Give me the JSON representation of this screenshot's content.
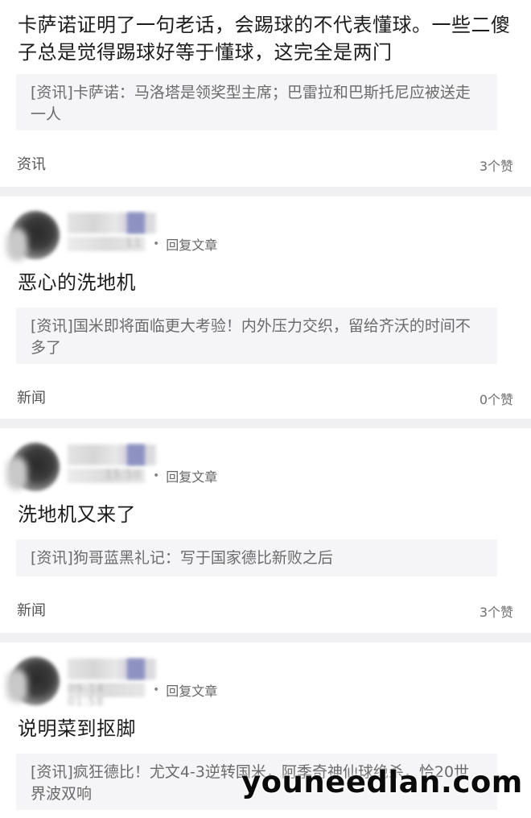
{
  "cards": [
    {
      "comment": "卡萨诺证明了一句老话，会踢球的不代表懂球。一些二傻子总是觉得踢球好等于懂球，这完全是两门",
      "quote": "[资讯]卡萨诺：马洛塔是领奖型主席；巴雷拉和巴斯托尼应被送走一人",
      "tag": "资讯",
      "likes": "3个赞"
    },
    {
      "time_fragment": "11",
      "reply_label": "回复文章",
      "comment": "恶心的洗地机",
      "quote": "[资讯]国米即将面临更大考验！内外压力交织，留给齐沃的时间不多了",
      "tag": "新闻",
      "likes": "0个赞"
    },
    {
      "time_fragment": "15:50",
      "reply_label": "回复文章",
      "comment": "洗地机又来了",
      "quote": "[资讯]狗哥蓝黑礼记：写于国家德比新败之后",
      "tag": "新闻",
      "likes": "3个赞"
    },
    {
      "time_fragment": "09-14 01:58",
      "reply_label": "回复文章",
      "comment": "说明菜到抠脚",
      "quote": "[资讯]疯狂德比！尤文4-3逆转国米，阿季奇神仙球绝杀，恰20世界波双响"
    }
  ],
  "watermark": "youneedlan.com"
}
